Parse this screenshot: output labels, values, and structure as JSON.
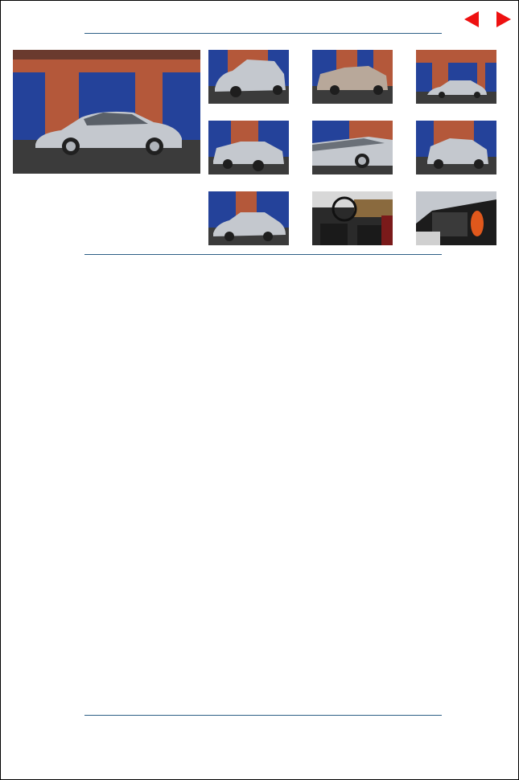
{
  "navigation": {
    "prev_icon": "triangle-left-icon",
    "next_icon": "triangle-right-icon",
    "arrow_color": "#ee1111"
  },
  "colors": {
    "rule": "#2d5f86",
    "brick": "#b4583a",
    "door": "#24429a",
    "car_silver": "#c4c8ce",
    "ground": "#3b3b3b"
  },
  "gallery": {
    "main_photo": {
      "view": "side-profile"
    },
    "thumbnails": [
      {
        "view": "front-three-quarter"
      },
      {
        "view": "rear-three-quarter"
      },
      {
        "view": "side-profile-distant"
      },
      {
        "view": "rear-three-quarter-left"
      },
      {
        "view": "side-detail-closeup"
      },
      {
        "view": "rear-view"
      },
      {
        "view": "front-three-quarter-low"
      },
      {
        "view": "interior-dashboard"
      },
      {
        "view": "engine-bay"
      }
    ]
  }
}
